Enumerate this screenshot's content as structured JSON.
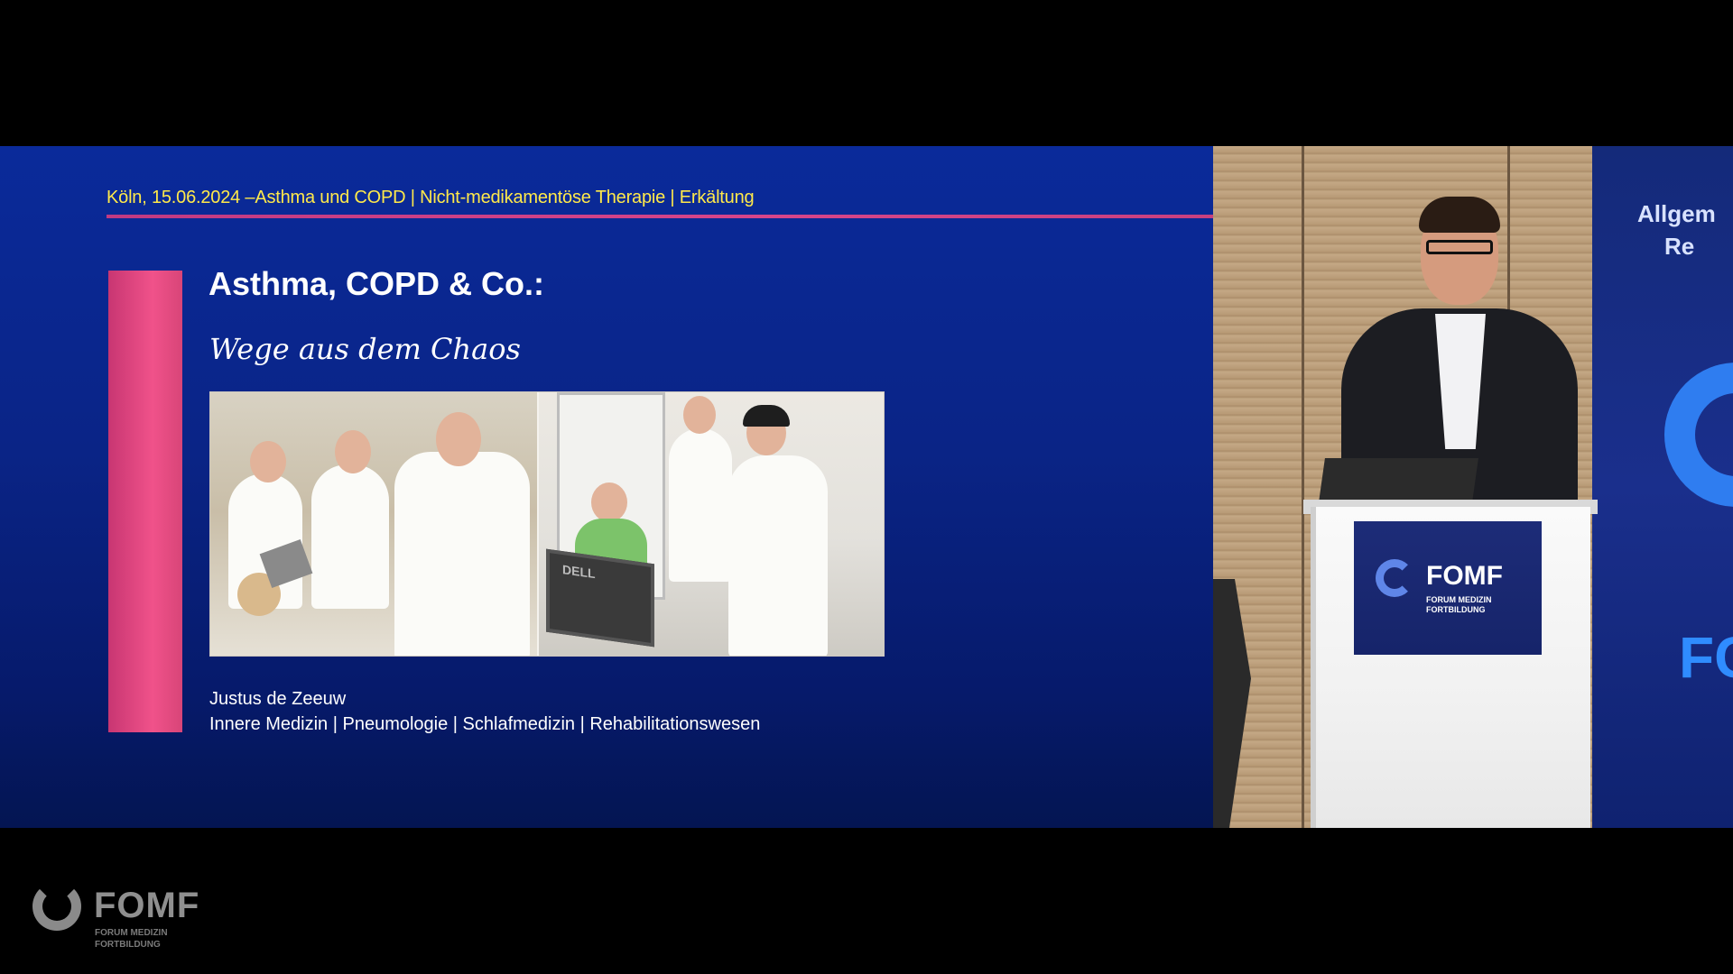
{
  "slide": {
    "header": "Köln, 15.06.2024 –Asthma und COPD | Nicht-medikamentöse Therapie | Erkältung",
    "title": "Asthma, COPD & Co.:",
    "subtitle": "Wege aus dem Chaos",
    "presenter_name": "Justus de Zeeuw",
    "presenter_specialties": "Innere Medizin | Pneumologie | Schlafmedizin | Rehabilitationswesen",
    "monitor_brand": "DELL"
  },
  "camera": {
    "banner_line1": "Allgem",
    "banner_line2": "Re",
    "banner_big": "FC",
    "lectern_logo": "FOMF",
    "lectern_logo_sub_line1": "FORUM MEDIZIN",
    "lectern_logo_sub_line2": "FORTBILDUNG"
  },
  "watermark": {
    "name": "FOMF",
    "sub_line1": "FORUM MEDIZIN",
    "sub_line2": "FORTBILDUNG"
  },
  "colors": {
    "slide_bg": "#0a2486",
    "header_text": "#ffe94a",
    "accent": "#f0528a"
  }
}
